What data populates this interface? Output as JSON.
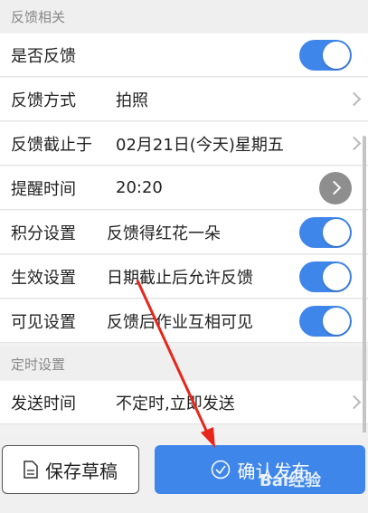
{
  "sections": {
    "feedback_header": "反馈相关",
    "schedule_header": "定时设置"
  },
  "rows": {
    "feedback_enabled": {
      "label": "是否反馈",
      "toggle_on": true
    },
    "feedback_method": {
      "label": "反馈方式",
      "value": "拍照"
    },
    "feedback_deadline": {
      "label": "反馈截止于",
      "value": "02月21日(今天)星期五"
    },
    "reminder_time": {
      "label": "提醒时间",
      "value": "20:20"
    },
    "points": {
      "label": "积分设置",
      "value": "反馈得红花一朵",
      "toggle_on": true
    },
    "effective": {
      "label": "生效设置",
      "value": "日期截止后允许反馈",
      "toggle_on": true
    },
    "visibility": {
      "label": "可见设置",
      "value": "反馈后作业互相可见",
      "toggle_on": true
    },
    "send_time": {
      "label": "发送时间",
      "value": "不定时,立即发送"
    }
  },
  "buttons": {
    "save_draft": "保存草稿",
    "confirm_publish": "确认发布"
  },
  "watermark": "Bai经验",
  "colors": {
    "accent": "#3f86ea",
    "arrow": "#e8251b"
  }
}
